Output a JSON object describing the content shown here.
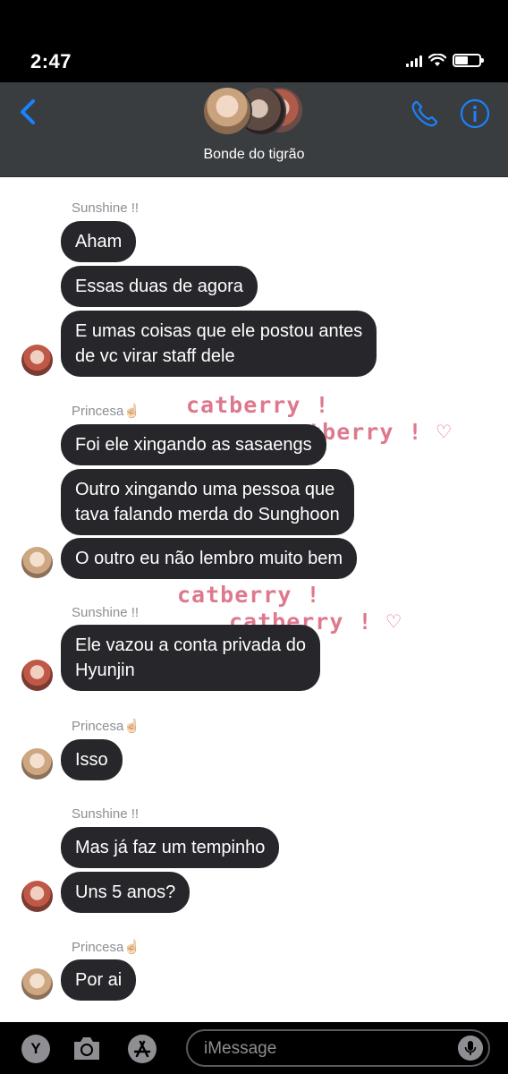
{
  "status_bar": {
    "time": "2:47"
  },
  "header": {
    "group_name": "Bonde do tigrão"
  },
  "messages": [
    {
      "sender": "Sunshine !!",
      "texts": [
        "Aham",
        "Essas duas de agora",
        "E umas coisas que ele postou antes\nde vc virar staff dele"
      ]
    },
    {
      "sender": "Princesa☝🏻",
      "texts": [
        "Foi ele xingando as sasaengs",
        "Outro xingando uma pessoa que\ntava falando merda do Sunghoon",
        "O outro eu não lembro muito bem"
      ]
    },
    {
      "sender": "Sunshine !!",
      "texts": [
        "Ele vazou a conta privada do\nHyunjin"
      ]
    },
    {
      "sender": "Princesa☝🏻",
      "texts": [
        "Isso"
      ]
    },
    {
      "sender": "Sunshine !!",
      "texts": [
        "Mas já faz um tempinho",
        "Uns 5 anos?"
      ]
    },
    {
      "sender": "Princesa☝🏻",
      "texts": [
        "Por ai"
      ]
    }
  ],
  "stickers": [
    "catberry !",
    "catberry ! ♡"
  ],
  "input": {
    "placeholder": "iMessage",
    "appstore_label": "Y"
  },
  "icons": [
    "back-chevron-icon",
    "phone-icon",
    "info-icon",
    "camera-icon",
    "appstore-icon",
    "microphone-icon"
  ],
  "colors": {
    "accent": "#1a82fb",
    "bubble": "#27262b",
    "header": "#3a3d40",
    "sticker": "#d9627a"
  }
}
